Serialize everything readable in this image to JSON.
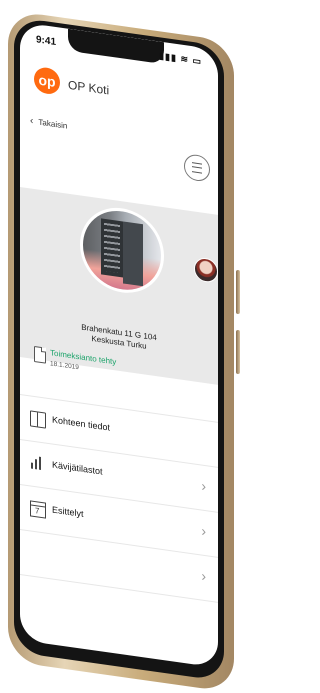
{
  "status_bar": {
    "time": "9:41",
    "icons_text": "▮▮▮ ≋ ▭"
  },
  "brand": {
    "logo_text": "op",
    "name": "OP Koti"
  },
  "nav": {
    "back_label": "Takaisin"
  },
  "property": {
    "address_line1": "Brahenkatu 11 G 104",
    "address_line2": "Keskusta Turku"
  },
  "status": {
    "title": "Toimeksianto tehty",
    "date": "18.1.2019"
  },
  "list": {
    "items": [
      {
        "label": "Kohteen tiedot"
      },
      {
        "label": "Kävijätilastot",
        "arrow": "›"
      },
      {
        "label": "Esittelyt",
        "arrow": "›"
      },
      {
        "label": "",
        "arrow": "›"
      }
    ]
  },
  "colors": {
    "brand_orange": "#ff6a10",
    "status_green": "#1ca36a"
  },
  "icons": [
    "chevron-left-icon",
    "hamburger-menu-icon",
    "document-icon",
    "book-icon",
    "bar-chart-icon",
    "calendar-icon",
    "chevron-right-icon"
  ]
}
